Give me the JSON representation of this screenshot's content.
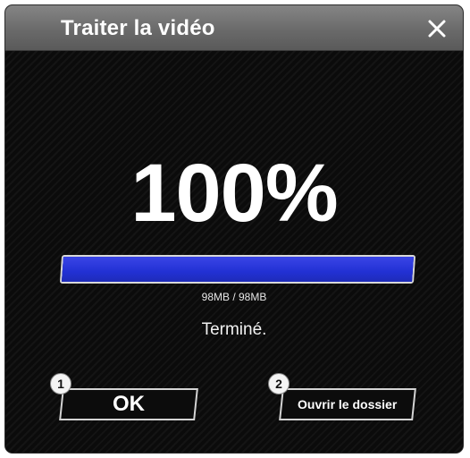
{
  "window": {
    "title": "Traiter la vidéo",
    "close_icon": "close-icon"
  },
  "progress": {
    "percent_label": "100%",
    "value": 1.0,
    "size_label": "98MB / 98MB",
    "status": "Terminé."
  },
  "buttons": {
    "ok": {
      "label": "OK",
      "badge": "1"
    },
    "open_folder": {
      "label": "Ouvrir le dossier",
      "badge": "2"
    }
  },
  "colors": {
    "progress_fill": "#2231d4",
    "background": "#0b0b0b",
    "titlebar": "#6a6a6a"
  }
}
